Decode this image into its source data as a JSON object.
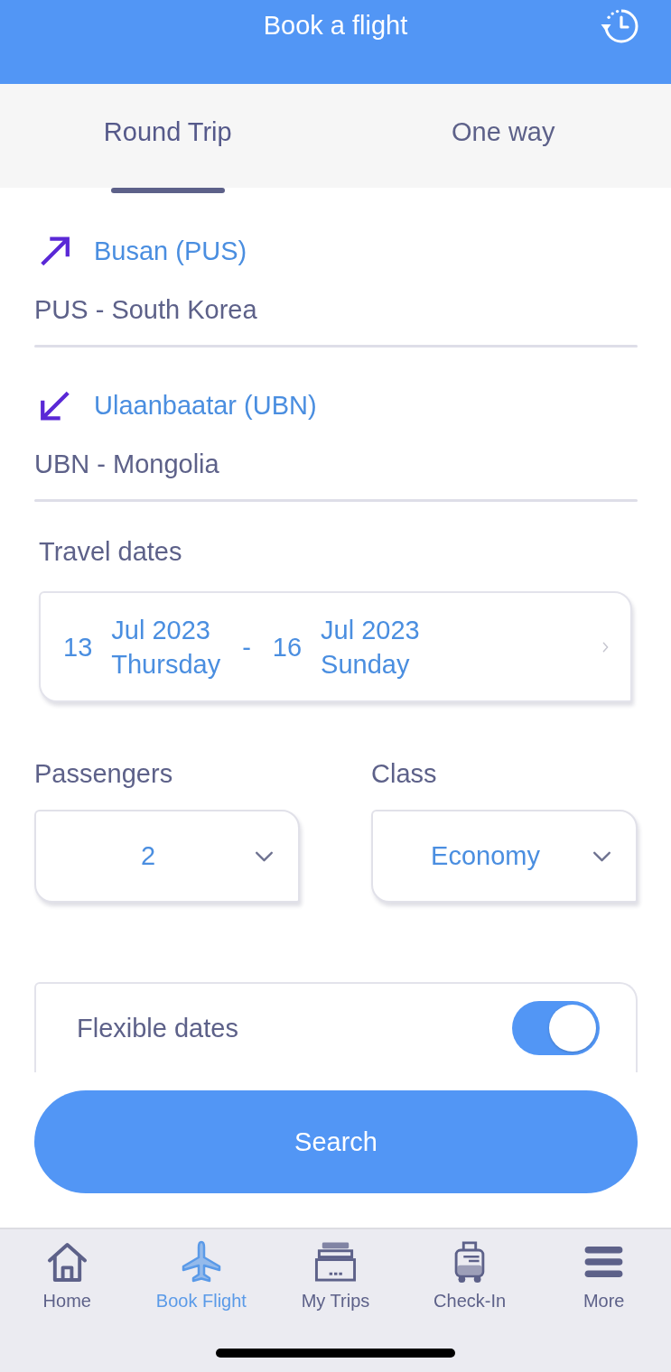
{
  "header": {
    "title": "Book a flight"
  },
  "tabs": [
    {
      "label": "Round Trip",
      "selected": true
    },
    {
      "label": "One way",
      "selected": false
    }
  ],
  "route": [
    {
      "kind": "departure",
      "city": "Busan (PUS)",
      "detail": "PUS - South Korea"
    },
    {
      "kind": "arrival",
      "city": "Ulaanbaatar (UBN)",
      "detail": "UBN - Mongolia"
    }
  ],
  "travel_dates": {
    "label": "Travel dates",
    "from": {
      "day": "13",
      "month": "Jul 2023",
      "weekday": "Thursday"
    },
    "separator": "-",
    "to": {
      "day": "16",
      "month": "Jul 2023",
      "weekday": "Sunday"
    }
  },
  "selects": [
    {
      "label": "Passengers",
      "value": "2"
    },
    {
      "label": "Class",
      "value": "Economy"
    }
  ],
  "flexible_dates": {
    "label": "Flexible dates",
    "on": true
  },
  "search_button": {
    "label": "Search"
  },
  "bottom_nav": [
    {
      "kind": "home",
      "label": "Home",
      "selected": false
    },
    {
      "kind": "flight",
      "label": "Book Flight",
      "selected": true
    },
    {
      "kind": "trips",
      "label": "My Trips",
      "selected": false
    },
    {
      "kind": "checkin",
      "label": "Check-In",
      "selected": false
    },
    {
      "kind": "more",
      "label": "More",
      "selected": false
    }
  ]
}
